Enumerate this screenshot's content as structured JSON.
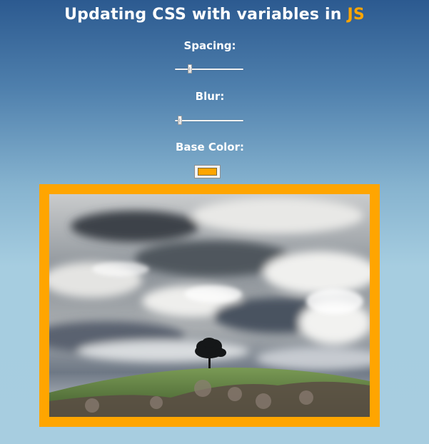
{
  "page": {
    "title_main": "Updating CSS with variables in ",
    "title_accent": "JS",
    "accent_color": "#ffa500"
  },
  "controls": {
    "spacing": {
      "label": "Spacing:",
      "value_fraction": 0.2
    },
    "blur": {
      "label": "Blur:",
      "value_fraction": 0.04
    },
    "base_color": {
      "label": "Base Color:",
      "value": "#ffa500"
    }
  },
  "image": {
    "description_icon": "landscape-photo-icon",
    "frame_color": "#ffa500"
  }
}
